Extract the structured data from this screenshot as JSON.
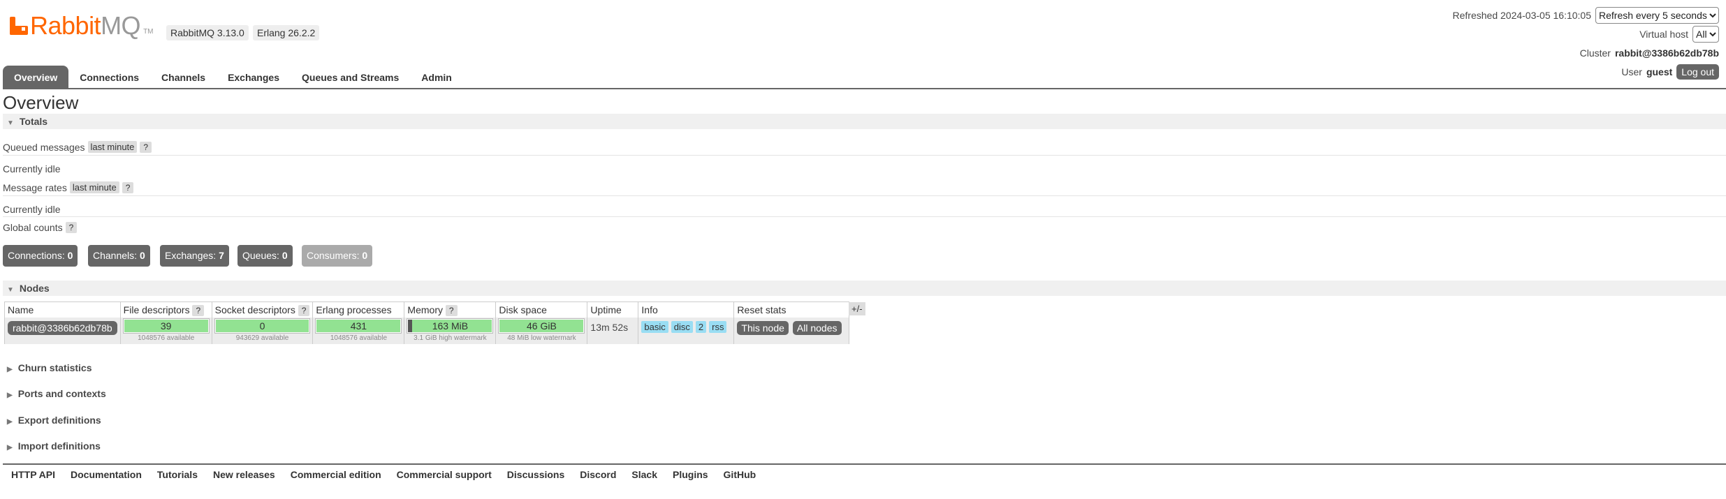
{
  "logo": {
    "text_rabbit": "Rabbit",
    "text_mq": "MQ",
    "tm": "TM"
  },
  "versions": {
    "rabbitmq": "RabbitMQ 3.13.0",
    "erlang": "Erlang 26.2.2"
  },
  "top_right": {
    "refreshed_label": "Refreshed 2024-03-05 16:10:05",
    "refresh_select": "Refresh every 5 seconds",
    "vhost_label": "Virtual host",
    "vhost_select": "All",
    "cluster_label": "Cluster",
    "cluster_name": "rabbit@3386b62db78b",
    "user_label": "User",
    "user_name": "guest",
    "logout": "Log out"
  },
  "tabs": [
    {
      "label": "Overview",
      "active": true
    },
    {
      "label": "Connections"
    },
    {
      "label": "Channels"
    },
    {
      "label": "Exchanges"
    },
    {
      "label": "Queues and Streams"
    },
    {
      "label": "Admin"
    }
  ],
  "page_title": "Overview",
  "totals": {
    "heading": "Totals",
    "queued_label": "Queued messages",
    "queued_period": "last minute",
    "help": "?",
    "queued_status": "Currently idle",
    "rates_label": "Message rates",
    "rates_period": "last minute",
    "rates_status": "Currently idle",
    "global_label": "Global counts",
    "counts": [
      {
        "label": "Connections:",
        "value": "0"
      },
      {
        "label": "Channels:",
        "value": "0"
      },
      {
        "label": "Exchanges:",
        "value": "7"
      },
      {
        "label": "Queues:",
        "value": "0"
      },
      {
        "label": "Consumers:",
        "value": "0"
      }
    ]
  },
  "nodes": {
    "heading": "Nodes",
    "columns": [
      "Name",
      "File descriptors",
      "Socket descriptors",
      "Erlang processes",
      "Memory",
      "Disk space",
      "Uptime",
      "Info",
      "Reset stats"
    ],
    "plus_minus": "+/-",
    "row": {
      "name": "rabbit@3386b62db78b",
      "file_desc": "39",
      "file_desc_sub": "1048576 available",
      "socket_desc": "0",
      "socket_desc_sub": "943629 available",
      "erlang_proc": "431",
      "erlang_proc_sub": "1048576 available",
      "memory": "163 MiB",
      "memory_sub": "3.1 GiB high watermark",
      "memory_fraction": 0.05,
      "disk": "46 GiB",
      "disk_sub": "48 MiB low watermark",
      "uptime": "13m 52s",
      "info": [
        "basic",
        "disc",
        "2",
        "rss"
      ],
      "reset_this": "This node",
      "reset_all": "All nodes"
    }
  },
  "collapsed_sections": [
    "Churn statistics",
    "Ports and contexts",
    "Export definitions",
    "Import definitions"
  ],
  "footer": [
    "HTTP API",
    "Documentation",
    "Tutorials",
    "New releases",
    "Commercial edition",
    "Commercial support",
    "Discussions",
    "Discord",
    "Slack",
    "Plugins",
    "GitHub"
  ]
}
